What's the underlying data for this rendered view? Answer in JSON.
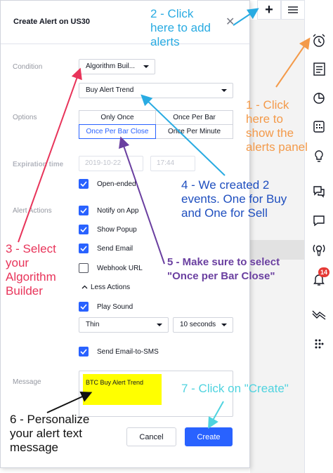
{
  "dialog": {
    "title": "Create Alert on US30",
    "close_glyph": "✕"
  },
  "toolbar": {
    "add_glyph": "+",
    "alerts_badge": "14"
  },
  "condition": {
    "label": "Condition",
    "source": "Algorithm Buil...",
    "event": "Buy Alert Trend"
  },
  "options": {
    "label": "Options",
    "items": [
      "Only Once",
      "Once Per Bar",
      "Once Per Bar Close",
      "Once Per Minute"
    ],
    "selected": "Once Per Bar Close"
  },
  "expiration": {
    "label": "Expiration time",
    "date": "2019-10-22",
    "time": "17:44",
    "open_ended_label": "Open-ended",
    "open_ended": true
  },
  "actions": {
    "label": "Alert Actions",
    "notify_app": "Notify on App",
    "show_popup": "Show Popup",
    "send_email": "Send Email",
    "webhook_url": "Webhook URL",
    "less_actions": "Less Actions",
    "play_sound": "Play Sound",
    "sound_name": "Thin",
    "sound_duration": "10 seconds",
    "email_to_sms": "Send Email-to-SMS",
    "checked": {
      "notify_app": true,
      "show_popup": true,
      "send_email": true,
      "webhook_url": false,
      "play_sound": true,
      "email_to_sms": true
    }
  },
  "message": {
    "label": "Message",
    "text": "BTC Buy Alert Trend"
  },
  "buttons": {
    "cancel": "Cancel",
    "create": "Create"
  },
  "annotations": {
    "step1": [
      "1 - Click",
      "here to",
      "show the",
      "alerts panel"
    ],
    "step2": [
      "2 - Click",
      "here to add",
      "alerts"
    ],
    "step3": [
      "3 - Select",
      "your",
      "Algorithm",
      "Builder"
    ],
    "step4": [
      "4 - We created 2",
      "events. One for Buy",
      "and One for Sell"
    ],
    "step5": [
      "5 - Make sure to select",
      "\"Once per Bar Close\""
    ],
    "step6": [
      "6 - Personalize",
      "your alert text",
      "message"
    ],
    "step7": [
      "7 - Click on \"Create\""
    ],
    "colors": {
      "step1": "#f39a4a",
      "step2": "#29abe2",
      "step3": "#e8345a",
      "step4": "#1f4fbf",
      "step5": "#6a3fa0",
      "step6": "#111111",
      "step7": "#4fd3df"
    }
  },
  "colors": {
    "accent": "#2962ff",
    "highlight": "#ffff00",
    "badge": "#e53935"
  }
}
